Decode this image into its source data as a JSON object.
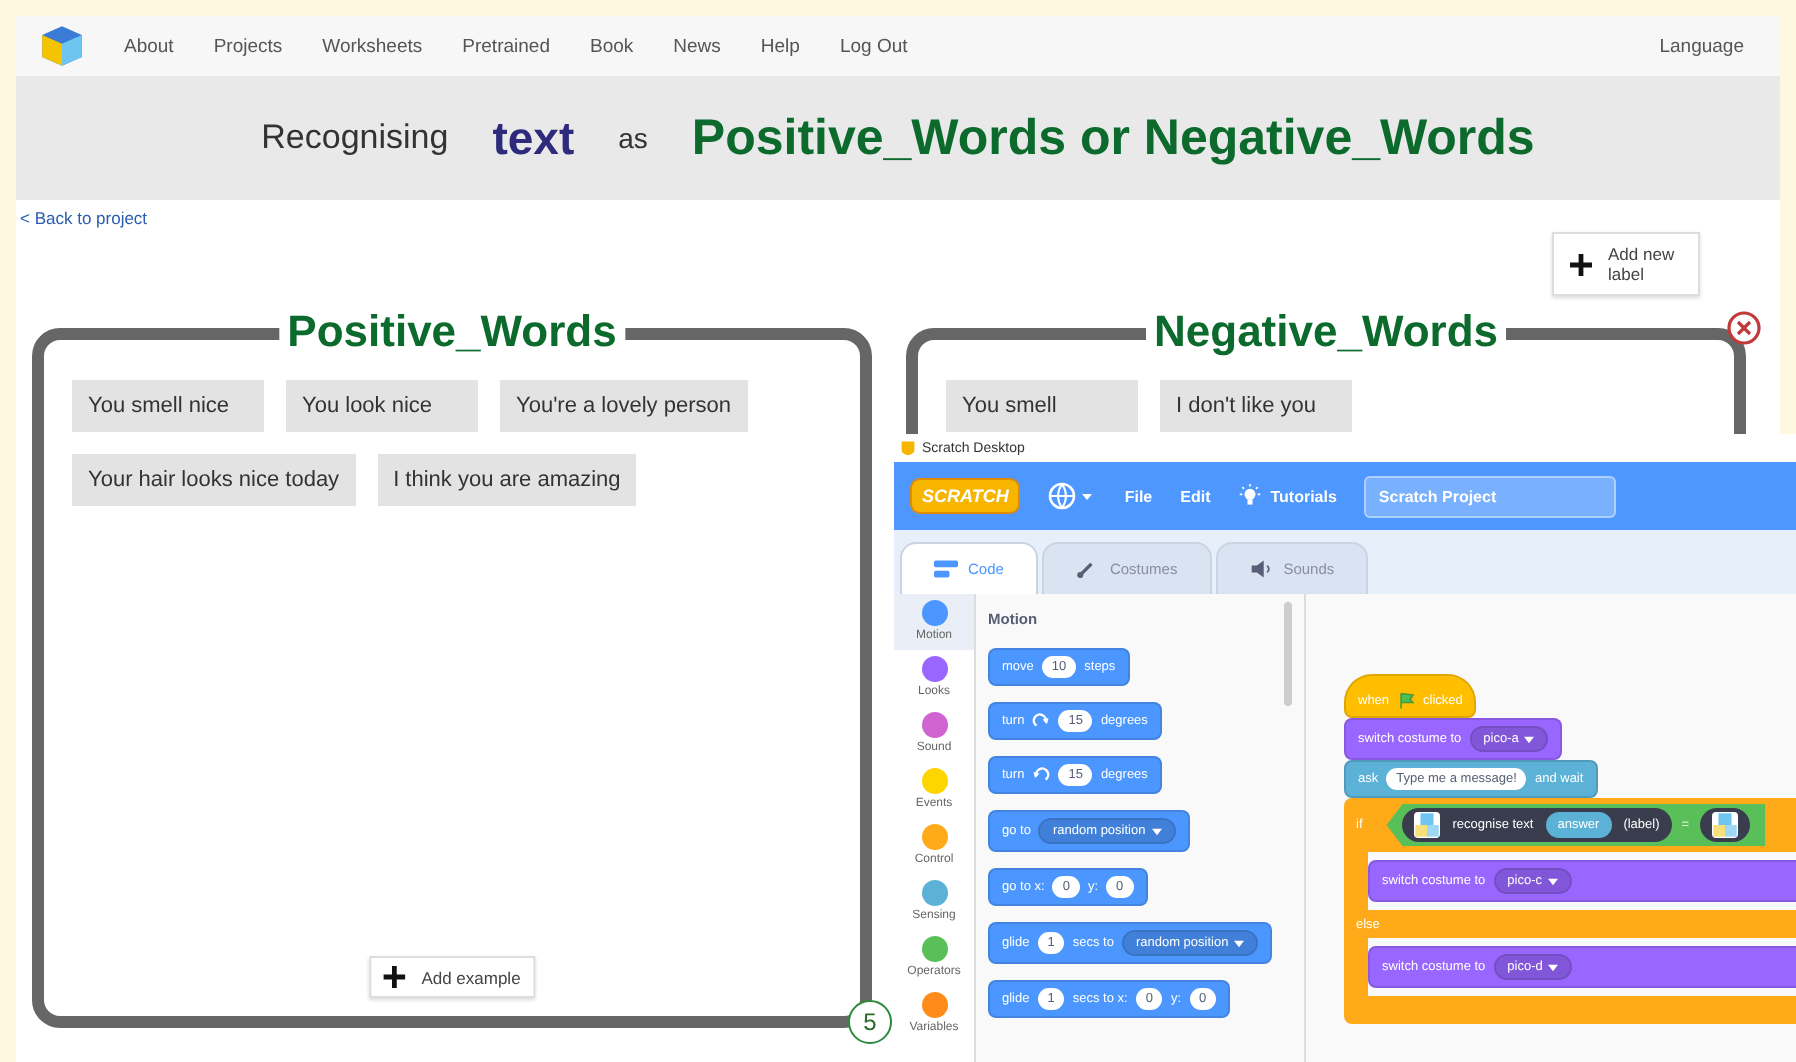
{
  "nav": {
    "links": [
      "About",
      "Projects",
      "Worksheets",
      "Pretrained",
      "Book",
      "News",
      "Help",
      "Log Out"
    ],
    "language": "Language"
  },
  "heading": {
    "prefix": "Recognising",
    "data_type": "text",
    "middle": "as",
    "labels": "Positive_Words or Negative_Words"
  },
  "back_link": "< Back to project",
  "add_label_button": "Add new label",
  "buckets": [
    {
      "title": "Positive_Words",
      "examples": [
        "You smell nice",
        "You look nice",
        "You're a lovely person",
        "Your hair looks nice today",
        "I think you are amazing"
      ],
      "add_example": "Add example",
      "count": "5",
      "deletable": false
    },
    {
      "title": "Negative_Words",
      "examples": [
        "You smell",
        "I don't like you"
      ],
      "deletable": true
    }
  ],
  "scratch": {
    "window_title": "Scratch Desktop",
    "logo": "SCRATCH",
    "menu": [
      "File",
      "Edit"
    ],
    "tutorials": "Tutorials",
    "project_title": "Scratch Project",
    "tabs": [
      {
        "label": "Code",
        "selected": true
      },
      {
        "label": "Costumes",
        "selected": false
      },
      {
        "label": "Sounds",
        "selected": false
      }
    ],
    "categories": [
      {
        "name": "Motion",
        "color": "#4c97ff",
        "selected": true
      },
      {
        "name": "Looks",
        "color": "#9966ff",
        "selected": false
      },
      {
        "name": "Sound",
        "color": "#cf63cf",
        "selected": false
      },
      {
        "name": "Events",
        "color": "#ffd500",
        "selected": false
      },
      {
        "name": "Control",
        "color": "#ffab19",
        "selected": false
      },
      {
        "name": "Sensing",
        "color": "#5cb1d6",
        "selected": false
      },
      {
        "name": "Operators",
        "color": "#59c059",
        "selected": false
      },
      {
        "name": "Variables",
        "color": "#ff8c1a",
        "selected": false
      }
    ],
    "palette_heading": "Motion",
    "palette_blocks": [
      [
        {
          "kind": "text",
          "text": "move"
        },
        {
          "kind": "number",
          "text": "10"
        },
        {
          "kind": "text",
          "text": "steps"
        }
      ],
      [
        {
          "kind": "text",
          "text": "turn"
        },
        {
          "kind": "rotate_cw"
        },
        {
          "kind": "number",
          "text": "15"
        },
        {
          "kind": "text",
          "text": "degrees"
        }
      ],
      [
        {
          "kind": "text",
          "text": "turn"
        },
        {
          "kind": "rotate_ccw"
        },
        {
          "kind": "number",
          "text": "15"
        },
        {
          "kind": "text",
          "text": "degrees"
        }
      ],
      [
        {
          "kind": "text",
          "text": "go to"
        },
        {
          "kind": "dropdown",
          "text": "random position"
        }
      ],
      [
        {
          "kind": "text",
          "text": "go to x:"
        },
        {
          "kind": "number",
          "text": "0"
        },
        {
          "kind": "text",
          "text": "y:"
        },
        {
          "kind": "number",
          "text": "0"
        }
      ],
      [
        {
          "kind": "text",
          "text": "glide"
        },
        {
          "kind": "number",
          "text": "1"
        },
        {
          "kind": "text",
          "text": "secs to"
        },
        {
          "kind": "dropdown",
          "text": "random position"
        }
      ],
      [
        {
          "kind": "text",
          "text": "glide"
        },
        {
          "kind": "number",
          "text": "1"
        },
        {
          "kind": "text",
          "text": "secs to x:"
        },
        {
          "kind": "number",
          "text": "0"
        },
        {
          "kind": "text",
          "text": "y:"
        },
        {
          "kind": "number",
          "text": "0"
        }
      ]
    ],
    "script": [
      {
        "kind": "hat",
        "parts": [
          {
            "kind": "text",
            "text": "when"
          },
          {
            "kind": "flag"
          },
          {
            "kind": "text",
            "text": "clicked"
          }
        ]
      },
      {
        "kind": "looks",
        "parts": [
          {
            "kind": "text",
            "text": "switch costume to"
          },
          {
            "kind": "dropdown",
            "text": "pico-a"
          }
        ]
      },
      {
        "kind": "sensing",
        "parts": [
          {
            "kind": "text",
            "text": "ask"
          },
          {
            "kind": "string",
            "text": "Type me a message!"
          },
          {
            "kind": "text",
            "text": "and wait"
          }
        ]
      },
      {
        "kind": "if_else",
        "label": "if",
        "condition": {
          "left": [
            {
              "kind": "extension_icon"
            },
            {
              "kind": "text",
              "text": "recognise text"
            },
            {
              "kind": "reporter",
              "text": "answer"
            },
            {
              "kind": "text",
              "text": "(label)"
            }
          ],
          "operator": "=",
          "right": [
            {
              "kind": "extension_icon"
            }
          ]
        },
        "then": [
          {
            "kind": "looks",
            "parts": [
              {
                "kind": "text",
                "text": "switch costume to"
              },
              {
                "kind": "dropdown",
                "text": "pico-c"
              }
            ]
          }
        ],
        "else_label": "else",
        "else": [
          {
            "kind": "looks",
            "parts": [
              {
                "kind": "text",
                "text": "switch costume to"
              },
              {
                "kind": "dropdown",
                "text": "pico-d"
              }
            ]
          }
        ]
      }
    ]
  }
}
